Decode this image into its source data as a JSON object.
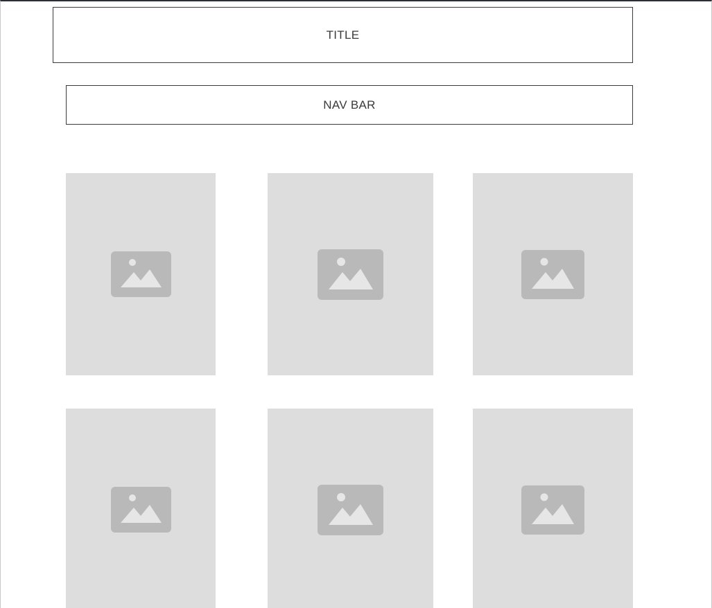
{
  "header": {
    "title": "TITLE"
  },
  "nav": {
    "label": "NAV BAR"
  },
  "gallery": {
    "items": [
      {
        "icon": "image-placeholder-icon"
      },
      {
        "icon": "image-placeholder-icon"
      },
      {
        "icon": "image-placeholder-icon"
      },
      {
        "icon": "image-placeholder-icon"
      },
      {
        "icon": "image-placeholder-icon"
      },
      {
        "icon": "image-placeholder-icon"
      }
    ]
  },
  "colors": {
    "placeholder_bg": "#dddddd",
    "icon": "#b9b9b9",
    "icon_glyph": "#e6e6e6",
    "border": "#3a3a3a"
  }
}
